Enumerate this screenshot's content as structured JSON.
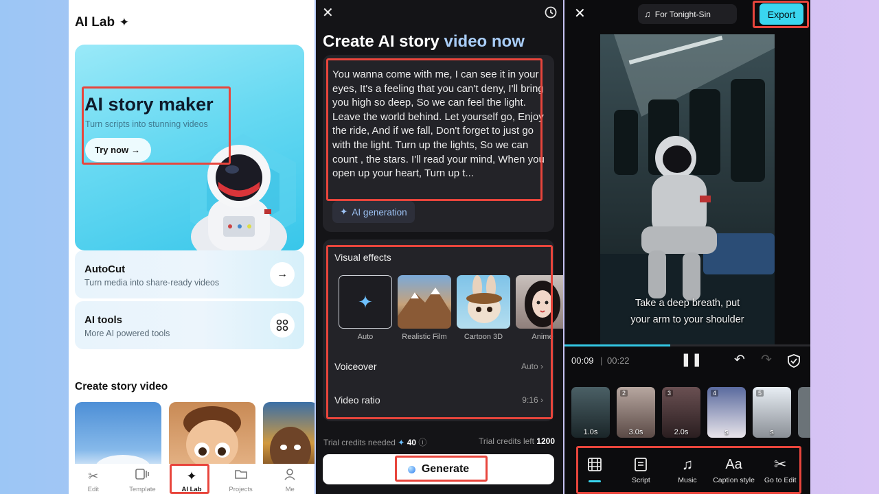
{
  "panel_lab": {
    "title": "AI Lab",
    "hero": {
      "title": "AI story maker",
      "subtitle": "Turn scripts into stunning videos",
      "button": "Try now"
    },
    "cards": [
      {
        "title": "AutoCut",
        "subtitle": "Turn media into share-ready videos",
        "icon": "arrow-right-icon"
      },
      {
        "title": "AI tools",
        "subtitle": "More AI powered tools",
        "icon": "grid-icon"
      }
    ],
    "section_title": "Create story video",
    "tabs": [
      {
        "label": "Edit",
        "icon": "scissors-icon"
      },
      {
        "label": "Template",
        "icon": "template-icon"
      },
      {
        "label": "AI Lab",
        "icon": "sparkle-icon",
        "active": true
      },
      {
        "label": "Projects",
        "icon": "folder-icon"
      },
      {
        "label": "Me",
        "icon": "person-icon"
      }
    ]
  },
  "panel_create": {
    "title_main": "Create AI story",
    "title_accent": "video now",
    "script": "You wanna come with me, I can see it in your eyes, It's a feeling that you can't deny, I'll bring you high so deep, So we can feel the light. Leave the world behind. Let yourself go, Enjoy the ride, And if we fall, Don't forget to just go with the light. Turn up the lights, So we can count , the stars. I'll read your mind, When you open up your heart, Turn up t...",
    "ai_generation": "AI generation",
    "visual_effects_label": "Visual effects",
    "effects": [
      {
        "label": "Auto",
        "selected": true
      },
      {
        "label": "Realistic Film"
      },
      {
        "label": "Cartoon 3D"
      },
      {
        "label": "Anime"
      }
    ],
    "voiceover": {
      "label": "Voiceover",
      "value": "Auto"
    },
    "video_ratio": {
      "label": "Video ratio",
      "value": "9:16"
    },
    "credits_needed_label": "Trial credits needed",
    "credits_needed_value": "40",
    "credits_left_label": "Trial credits left",
    "credits_left_value": "1200",
    "generate": "Generate"
  },
  "panel_editor": {
    "music": "For Tonight-Sin",
    "export": "Export",
    "caption_line1": "Take a deep breath, put",
    "caption_line2": "your arm to your shoulder",
    "time_current": "00:09",
    "time_total": "00:22",
    "progress": 0.43,
    "clips": [
      {
        "num": "",
        "duration": "1.0s"
      },
      {
        "num": "2",
        "duration": "3.0s"
      },
      {
        "num": "3",
        "duration": "2.0s"
      },
      {
        "num": "4",
        "duration": "s"
      },
      {
        "num": "5",
        "duration": "s"
      }
    ],
    "tools": [
      {
        "label": "",
        "icon": "storyboard-icon",
        "active": true
      },
      {
        "label": "Script",
        "icon": "script-icon"
      },
      {
        "label": "Music",
        "icon": "music-icon"
      },
      {
        "label": "Caption style",
        "icon": "caption-icon"
      },
      {
        "label": "Go to Edit",
        "icon": "scissors-icon"
      }
    ]
  }
}
